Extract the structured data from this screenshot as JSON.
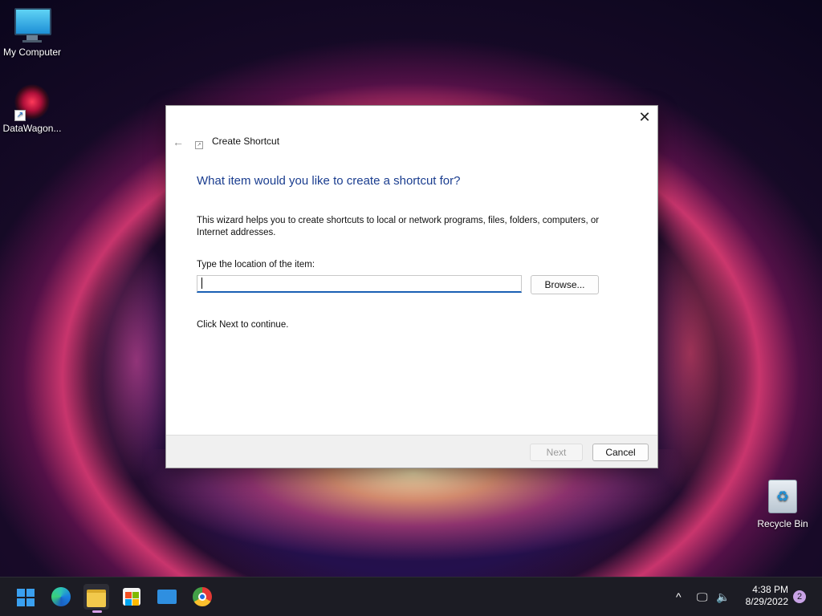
{
  "desktop": {
    "icons": [
      {
        "label": "My Computer"
      },
      {
        "label": "DataWagon..."
      },
      {
        "label": "Recycle Bin"
      }
    ]
  },
  "dialog": {
    "close_symbol": "✕",
    "back_symbol": "←",
    "title": "Create Shortcut",
    "heading": "What item would you like to create a shortcut for?",
    "description": "This wizard helps you to create shortcuts to local or network programs, files, folders, computers, or Internet addresses.",
    "location_label": "Type the location of the item:",
    "location_value": "",
    "location_placeholder": "",
    "browse_label": "Browse...",
    "continue_text": "Click Next to continue.",
    "next_label": "Next",
    "cancel_label": "Cancel"
  },
  "taskbar": {
    "apps": [
      "start-icon",
      "edge-icon",
      "file-explorer-icon",
      "store-icon",
      "mail-icon",
      "chrome-icon"
    ],
    "tray": {
      "chevron": "^",
      "time": "4:38 PM",
      "date": "8/29/2022",
      "notification_count": "2"
    }
  },
  "colors": {
    "heading": "#1a3d8f",
    "input_focus": "#1a5fb4",
    "taskbar": "#1c1c24"
  }
}
